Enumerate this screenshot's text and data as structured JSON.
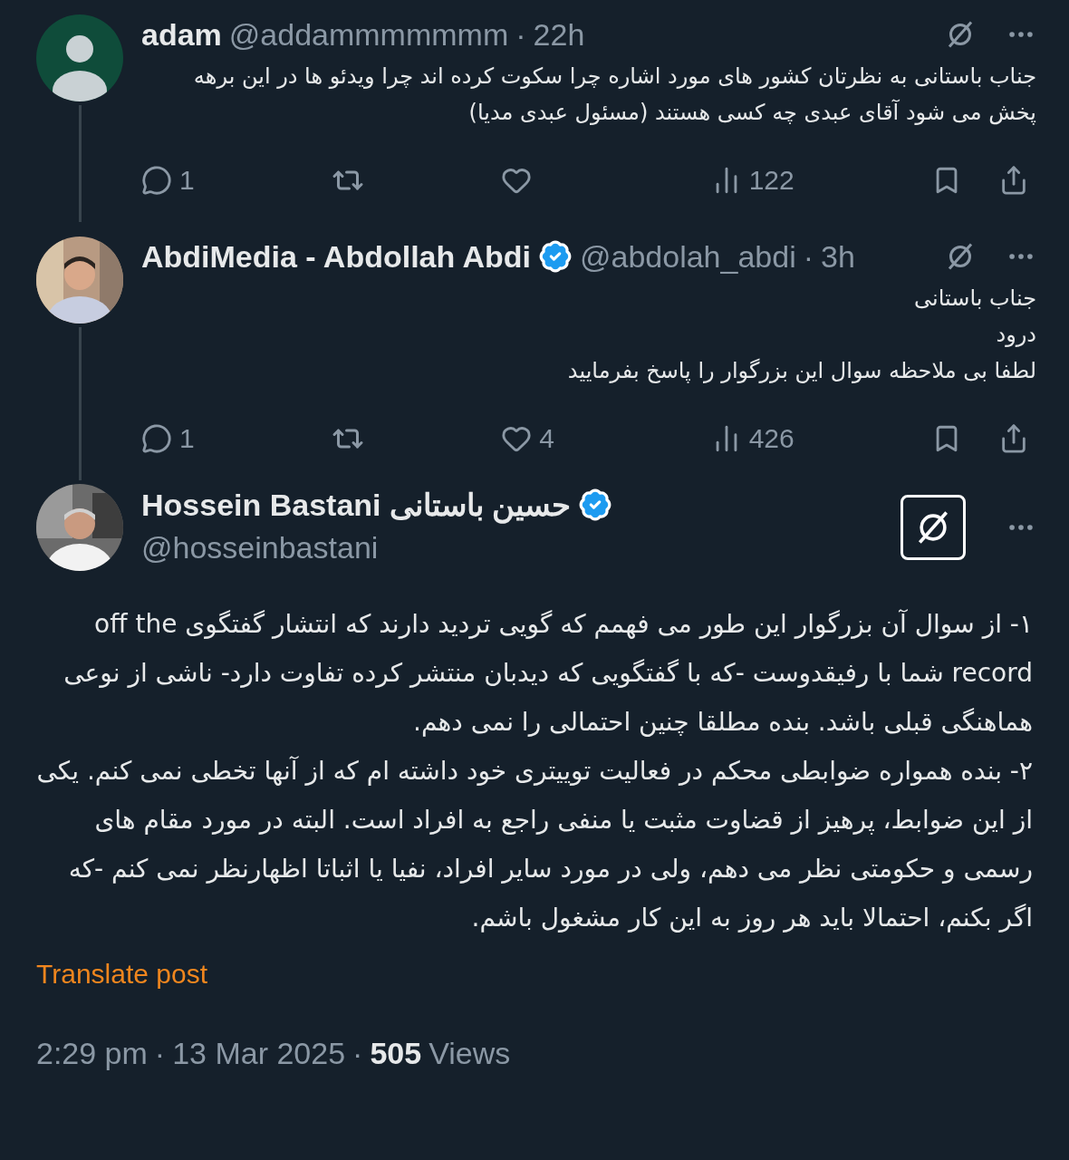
{
  "replies": [
    {
      "kind": "default",
      "name": "adam",
      "verified": false,
      "handle": "@addammmmmmm",
      "separator": "·",
      "time": "22h",
      "grok_boxed": false,
      "lines": [
        "جناب باستانی به نظرتان کشور های مورد اشاره چرا سکوت کرده اند چرا ویدئو ها در این برهه پخش می شود آقای عبدی چه کسی هستند (مسئول عبدی مدیا)"
      ],
      "replies_count": "1",
      "views": "122"
    },
    {
      "name": "AbdiMedia - Abdollah Abdi",
      "verified": true,
      "handle": "@abdolah_abdi",
      "separator": "·",
      "time": "3h",
      "grok_boxed": false,
      "lines": [
        "جناب باستانی",
        "درود",
        "لطفا بی ملاحظه سوال این بزرگوار را پاسخ بفرمایید"
      ],
      "replies_count": "1",
      "likes": "4",
      "views": "426"
    }
  ],
  "main": {
    "name": "Hossein Bastani حسین باستانی",
    "verified": true,
    "handle": "@hosseinbastani",
    "grok_boxed": true,
    "paragraphs": [
      "۱- از سوال آن بزرگوار این طور می فهمم که گویی تردید دارند که انتشار گفتگوی off the record شما با رفیقدوست -که با گفتگویی که دیدبان منتشر کرده تفاوت دارد- ناشی از نوعی هماهنگی قبلی باشد. بنده مطلقا چنین احتمالی را نمی دهم.",
      "۲- بنده همواره ضوابطی محکم در فعالیت توییتری خود داشته ام که از آنها تخطی نمی کنم. یکی از این ضوابط، پرهیز از قضاوت مثبت یا منفی راجع به افراد است. البته در مورد مقام های رسمی و حکومتی نظر می دهم، ولی در مورد سایر افراد، نفیا یا اثباتا اظهارنظر نمی کنم -که اگر بکنم، احتمالا باید هر روز به این کار مشغول باشم."
    ],
    "translate": "Translate post",
    "time": "2:29 pm",
    "separator_1": "·",
    "date": "13 Mar 2025",
    "separator_2": "·",
    "views_count": "505",
    "views_label": "Views"
  }
}
